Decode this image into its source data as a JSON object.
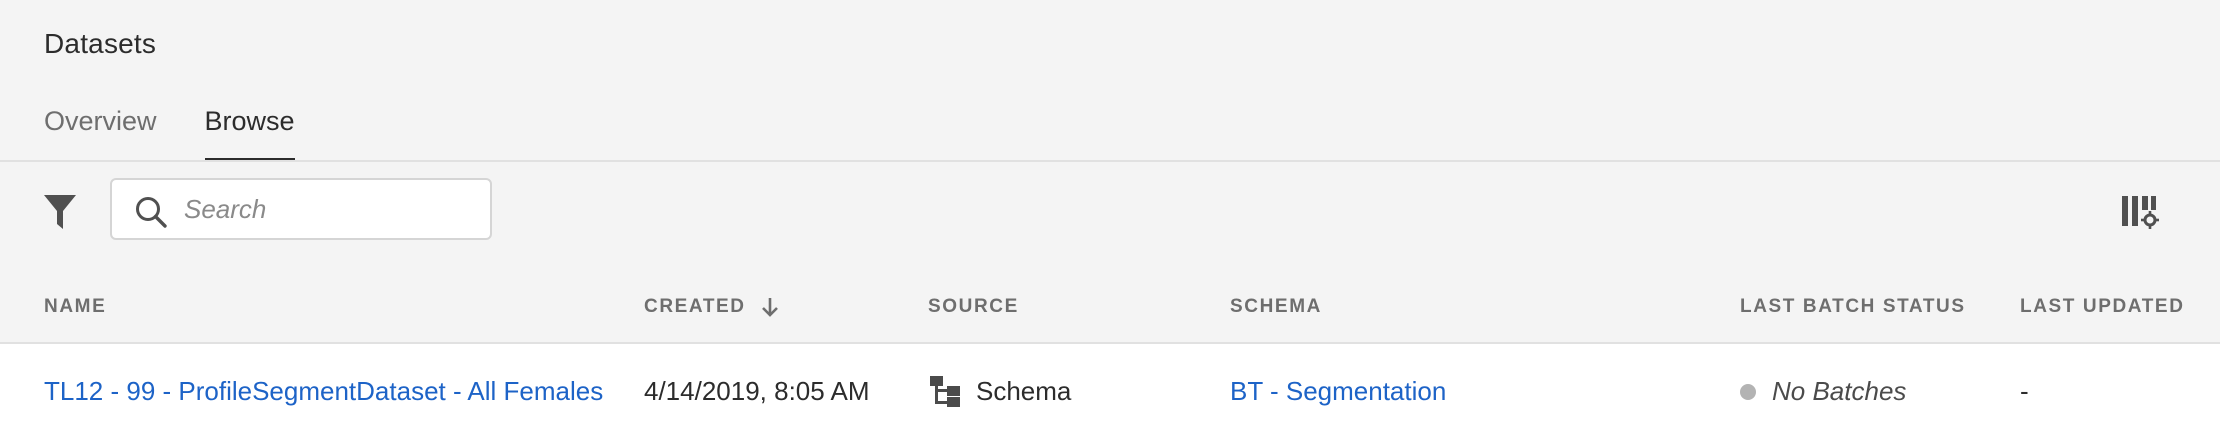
{
  "page": {
    "title": "Datasets"
  },
  "tabs": [
    {
      "label": "Overview",
      "active": false
    },
    {
      "label": "Browse",
      "active": true
    }
  ],
  "toolbar": {
    "filter_icon": "filter-funnel-icon",
    "search": {
      "placeholder": "Search",
      "value": ""
    },
    "column_settings_icon": "column-settings-icon"
  },
  "table": {
    "columns": [
      {
        "label": "NAME"
      },
      {
        "label": "CREATED",
        "sorted": "descending"
      },
      {
        "label": "SOURCE"
      },
      {
        "label": "SCHEMA"
      },
      {
        "label": "LAST BATCH STATUS"
      },
      {
        "label": "LAST UPDATED"
      }
    ],
    "rows": [
      {
        "name": "TL12 - 99 - ProfileSegmentDataset - All Females",
        "created": "4/14/2019, 8:05 AM",
        "source": "Schema",
        "source_icon": "schema-hierarchy-icon",
        "schema": "BT - Segmentation",
        "last_batch_status": "No Batches",
        "last_updated": "-"
      }
    ]
  },
  "colors": {
    "link": "#1d63c7",
    "background": "#f4f4f4",
    "row_background": "#ffffff",
    "status_dot": "#b3b3b3"
  }
}
